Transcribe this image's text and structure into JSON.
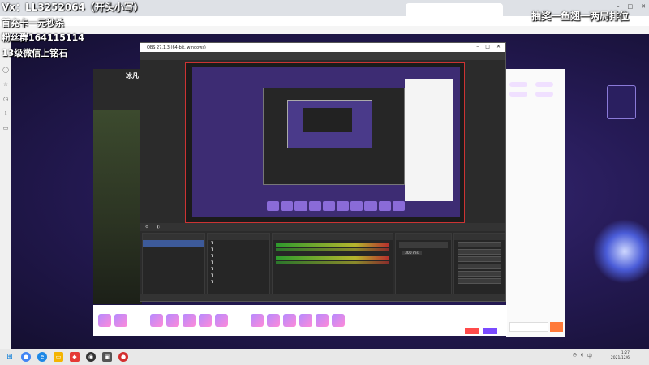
{
  "overlay": {
    "line1": "Vx：LL3252064（开头小写）",
    "line2": "首充卡一元秒杀",
    "line3": "粉丝群164115114",
    "line4": "13级微信上铭石",
    "right": "抽奖一鱼翅一两局排位"
  },
  "browser": {
    "tab_title": "",
    "bookmarks": [
      "",
      "",
      "",
      "",
      ""
    ]
  },
  "stream": {
    "streamer_name": "冰凡"
  },
  "obs": {
    "title": "OBS 27.1.3 (64-bit, windows)",
    "menu": [
      "",
      "",
      "",
      "",
      "",
      ""
    ],
    "scenes_title": "",
    "sources_title": "",
    "mixer_title": "",
    "transition_title": "",
    "controls_title": "",
    "sources": [
      {
        "type": "T",
        "name": ""
      },
      {
        "type": "T",
        "name": ""
      },
      {
        "type": "T",
        "name": ""
      },
      {
        "type": "T",
        "name": ""
      },
      {
        "type": "T",
        "name": ""
      },
      {
        "type": "T",
        "name": ""
      },
      {
        "type": "T",
        "name": ""
      }
    ],
    "mixer_channels": [
      "",
      ""
    ],
    "duration_label": "",
    "duration_value": "300 ms",
    "controls": [
      "",
      "",
      "",
      "",
      "",
      ""
    ],
    "footer": [
      "",
      "",
      "",
      ""
    ]
  },
  "chat": {
    "tabs": [
      "",
      ""
    ],
    "lines": [
      "",
      "",
      "",
      "",
      "",
      "",
      "",
      "",
      "",
      "",
      ""
    ],
    "input_placeholder": "",
    "send_label": ""
  },
  "gifts": {
    "charge": "",
    "charge2": ""
  },
  "taskbar": {
    "time": "1:27",
    "date": "2021/12/6"
  }
}
